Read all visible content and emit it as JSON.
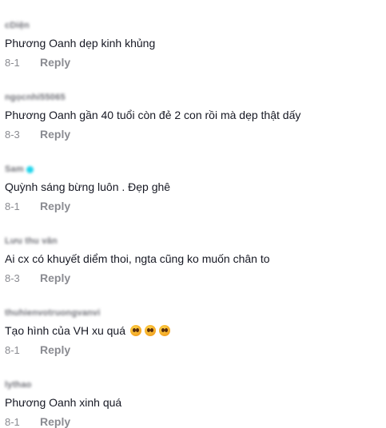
{
  "comments": [
    {
      "username": "cDiện",
      "text": "Phương Oanh dẹp kinh khủng",
      "date": "8-1",
      "reply_label": "Reply"
    },
    {
      "username": "ngọcnhi55065",
      "text": "Phương Oanh gần 40 tuổi còn đẻ 2 con rồi mà dẹp thật dấy",
      "date": "8-3",
      "reply_label": "Reply"
    },
    {
      "username": "Sam",
      "text": "Quỳnh sáng bừng luôn . Đẹp ghê",
      "date": "8-1",
      "reply_label": "Reply"
    },
    {
      "username": "Lưu thu vân",
      "text": "Ai cx có khuyết diểm thoi, ngta cũng ko muốn chân to",
      "date": "8-3",
      "reply_label": "Reply"
    },
    {
      "username": "thuhienvotruongvanvi",
      "text": "Tạo hình của VH xu quá",
      "emoji": [
        "pleading-face-icon",
        "pleading-face-icon",
        "pleading-face-icon"
      ],
      "date": "8-1",
      "reply_label": "Reply"
    },
    {
      "username": "lythao",
      "text": "Phương Oanh xinh quá",
      "date": "8-1",
      "reply_label": "Reply"
    }
  ]
}
